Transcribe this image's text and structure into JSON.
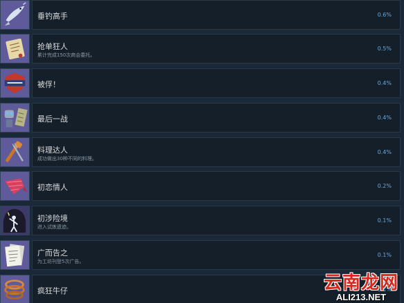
{
  "achievements": [
    {
      "title": "垂钓高手",
      "desc": "",
      "pct": "0.6%",
      "icon": "fish-icon"
    },
    {
      "title": "抢单狂人",
      "desc": "累计完成150次商会委托。",
      "pct": "0.5%",
      "icon": "scroll-icon"
    },
    {
      "title": "被俘！",
      "desc": "",
      "pct": "0.4%",
      "icon": "pirate-badge-icon"
    },
    {
      "title": "最后一战",
      "desc": "",
      "pct": "0.4%",
      "icon": "robot-icon"
    },
    {
      "title": "料理达人",
      "desc": "成功做出30种不同的料理。",
      "pct": "0.4%",
      "icon": "cooking-utensils-icon"
    },
    {
      "title": "初恋情人",
      "desc": "",
      "pct": "0.2%",
      "icon": "pink-scarf-icon"
    },
    {
      "title": "初涉险境",
      "desc": "进入试炼遗迹。",
      "pct": "0.1%",
      "icon": "explorer-icon"
    },
    {
      "title": "广而告之",
      "desc": "为工坊刊登5次广告。",
      "pct": "0.1%",
      "icon": "poster-icon"
    },
    {
      "title": "疯狂牛仔",
      "desc": "",
      "pct": "0.1%",
      "icon": "lasso-icon"
    }
  ],
  "watermark": {
    "cn": "云南龙网",
    "en": "ALI213.NET"
  }
}
